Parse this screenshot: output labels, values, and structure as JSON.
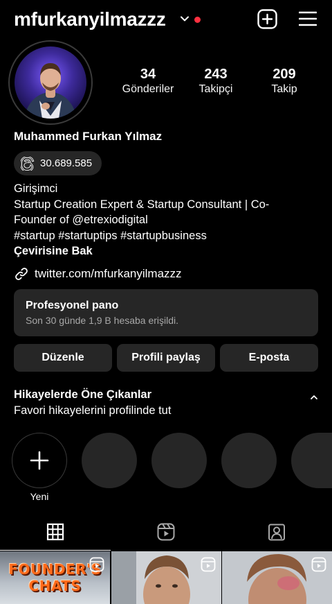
{
  "header": {
    "username": "mfurkanyilmazzz",
    "icons": [
      "chevron-down-icon",
      "new-post-icon",
      "menu-icon"
    ],
    "notification_dot_color": "#ff3040"
  },
  "profile": {
    "stats": [
      {
        "value": "34",
        "label": "Gönderiler"
      },
      {
        "value": "243",
        "label": "Takipçi"
      },
      {
        "value": "209",
        "label": "Takip"
      }
    ],
    "full_name": "Muhammed Furkan Yılmaz",
    "threads_count": "30.689.585",
    "bio_lines": [
      "Girişimci",
      "Startup Creation Expert & Startup Consultant | Co-",
      "Founder of @etrexiodigital",
      "#startup #startuptips #startupbusiness"
    ],
    "translate_label": "Çevirisine Bak",
    "link_text": "twitter.com/mfurkanyilmazzz"
  },
  "dashboard": {
    "title": "Profesyonel pano",
    "subtitle": "Son 30 günde 1,9 B hesaba erişildi."
  },
  "actions": {
    "edit_label": "Düzenle",
    "share_label": "Profili paylaş",
    "email_label": "E-posta"
  },
  "highlights": {
    "title": "Hikayelerde Öne Çıkanlar",
    "subtitle": "Favori hikayelerini profilinde tut",
    "new_label": "Yeni"
  },
  "tabs": [
    "grid-icon",
    "reels-icon",
    "tagged-icon"
  ],
  "posts": {
    "first_post_text": "FOUNDER'S CHATS"
  },
  "colors": {
    "background": "#000000",
    "card": "#262626",
    "secondary_text": "#a8a8a8"
  }
}
